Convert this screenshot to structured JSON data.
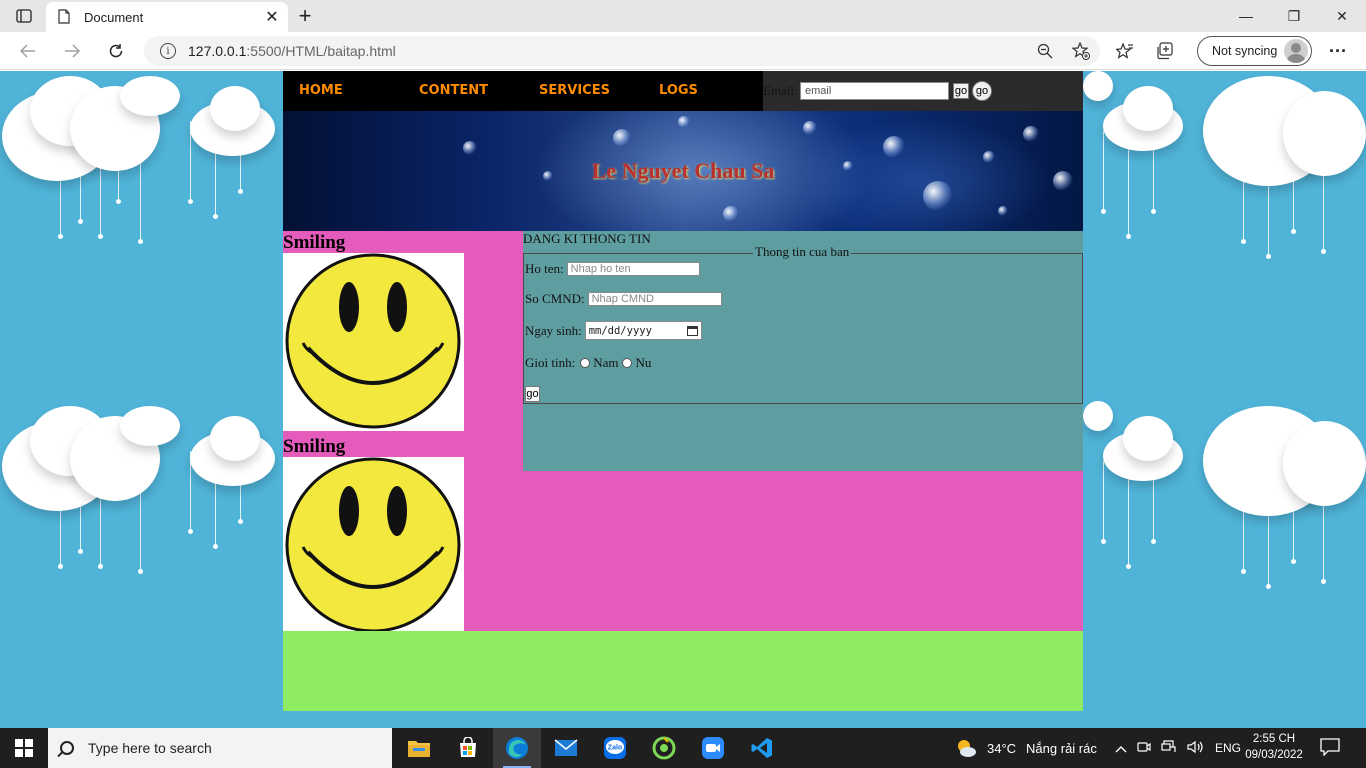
{
  "browser": {
    "tab_title": "Document",
    "close_glyph": "✕",
    "new_tab_glyph": "+",
    "url_host": "127.0.0.1",
    "url_path": ":5500/HTML/baitap.html",
    "sync_label": "Not syncing",
    "more_glyph": "···",
    "window_controls": {
      "minimize": "—",
      "restore": "❐",
      "close": "✕"
    }
  },
  "nav": {
    "items": [
      {
        "label": "HOME"
      },
      {
        "label": "CONTENT"
      },
      {
        "label": "SERVICES"
      },
      {
        "label": "LOGS"
      }
    ],
    "email_label": "Email:",
    "email_placeholder": "email",
    "go_square_label": "go",
    "go_round_label": "go"
  },
  "banner": {
    "title": "Le Nguyet Chau Sa"
  },
  "sidebar": {
    "blocks": [
      {
        "heading": "Smiling"
      },
      {
        "heading": "Smiling"
      }
    ]
  },
  "form": {
    "heading": "DANG KI THONG TIN",
    "legend": "Thong tin cua ban",
    "name_label": "Ho ten:",
    "name_placeholder": "Nhap ho ten",
    "id_label": "So CMND:",
    "id_placeholder": "Nhap CMND",
    "dob_label": "Ngay sinh:",
    "dob_placeholder": "mm/dd/yyyy",
    "gender_label": "Gioi tinh:",
    "gender_options": [
      "Nam",
      "Nu"
    ],
    "submit_label": "go"
  },
  "taskbar": {
    "search_placeholder": "Type here to search",
    "apps": [
      "file-explorer",
      "microsoft-store",
      "edge",
      "mail",
      "zalo",
      "app-green",
      "zoom",
      "vscode"
    ],
    "zalo_label": "Zalo",
    "weather_temp": "34°C",
    "weather_text": "Nắng rải rác",
    "language": "ENG",
    "time": "2:55 CH",
    "date": "09/03/2022"
  },
  "colors": {
    "page_background": "#50b4d9",
    "menu_text": "#ff8c00",
    "sidebar_bg": "#e55bbc",
    "form_bg": "#5f9ea0",
    "footer_bg": "#8eeb62",
    "banner_title": "#b83030"
  }
}
